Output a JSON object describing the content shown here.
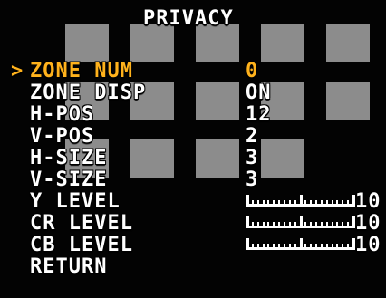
{
  "title": "PRIVACY",
  "cursor": ">",
  "menu": [
    {
      "label": "ZONE NUM",
      "value": "0",
      "selected": true
    },
    {
      "label": "ZONE DISP",
      "value": "ON",
      "selected": false
    },
    {
      "label": "H-POS",
      "value": "12",
      "selected": false
    },
    {
      "label": "V-POS",
      "value": "2",
      "selected": false
    },
    {
      "label": "H-SIZE",
      "value": "3",
      "selected": false
    },
    {
      "label": "V-SIZE",
      "value": "3",
      "selected": false
    },
    {
      "label": "Y LEVEL",
      "bar_value": "10",
      "selected": false
    },
    {
      "label": "CR LEVEL",
      "bar_value": "10",
      "selected": false
    },
    {
      "label": "CB LEVEL",
      "bar_value": "10",
      "selected": false
    },
    {
      "label": "RETURN",
      "selected": false
    }
  ],
  "colors": {
    "selected_text": "#ffb21c",
    "normal_text": "#ffffff",
    "privacy_mask": "#8c8c8c",
    "background": "#030303"
  }
}
